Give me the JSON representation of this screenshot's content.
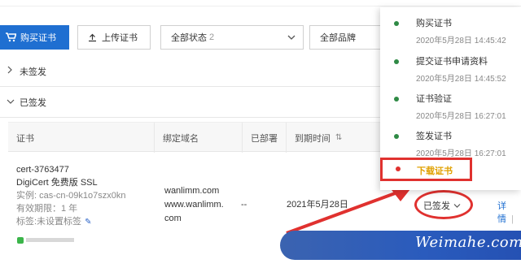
{
  "toolbar": {
    "buy_label": "购买证书",
    "upload_label": "上传证书",
    "status_filter": {
      "value": "全部状态",
      "count": "2"
    },
    "brand_filter": {
      "value": "全部品牌"
    }
  },
  "groups": {
    "unissued": "未签发",
    "issued": "已签发"
  },
  "table": {
    "columns": [
      "证书",
      "绑定域名",
      "已部署",
      "到期时间"
    ],
    "row": {
      "cert_id": "cert-3763477",
      "cert_type": "DigiCert 免费版 SSL",
      "instance": "实例: cas-cn-09k1o7szx0kn",
      "validity": "有效期限：1 年",
      "tags": "标签:未设置标签",
      "domains": [
        "wanlimm.com",
        "www.wanlimm.",
        "com"
      ],
      "deployed": "--",
      "expiry": "2021年5月28日",
      "status": "已签发",
      "detail": "详情"
    }
  },
  "timeline": [
    {
      "name": "购买证书",
      "time": "2020年5月28日 14:45:42"
    },
    {
      "name": "提交证书申请资料",
      "time": "2020年5月28日 14:45:52"
    },
    {
      "name": "证书验证",
      "time": "2020年5月28日 16:27:01"
    },
    {
      "name": "签发证书",
      "time": "2020年5月28日 16:27:01"
    },
    {
      "name": "下载证书"
    }
  ],
  "watermark": "Weimahe.com",
  "colors": {
    "primary": "#1f6fd1",
    "step_done": "#2f8a45",
    "annotation_red": "#e0312f",
    "download_text": "#e0a000"
  }
}
